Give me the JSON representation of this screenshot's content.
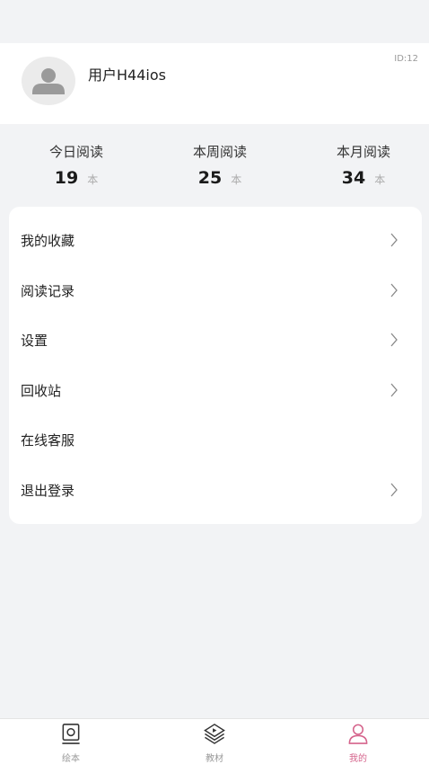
{
  "profile": {
    "username": "用户H44ios",
    "user_id": "ID:12"
  },
  "stats": [
    {
      "label": "今日阅读",
      "value": "19",
      "unit": "本"
    },
    {
      "label": "本周阅读",
      "value": "25",
      "unit": "本"
    },
    {
      "label": "本月阅读",
      "value": "34",
      "unit": "本"
    }
  ],
  "menu": [
    {
      "label": "我的收藏",
      "chevron": true
    },
    {
      "label": "阅读记录",
      "chevron": true
    },
    {
      "label": "设置",
      "chevron": true
    },
    {
      "label": "回收站",
      "chevron": true
    },
    {
      "label": "在线客服",
      "chevron": false
    },
    {
      "label": "退出登录",
      "chevron": true
    }
  ],
  "tabbar": {
    "tabs": [
      {
        "label": "绘本",
        "icon": "picture-book-icon",
        "active": false
      },
      {
        "label": "教材",
        "icon": "textbook-play-icon",
        "active": false
      },
      {
        "label": "我的",
        "icon": "user-profile-icon",
        "active": true
      }
    ]
  },
  "colors": {
    "background": "#f2f3f5",
    "accent": "#d5648c",
    "muted": "#999999"
  }
}
